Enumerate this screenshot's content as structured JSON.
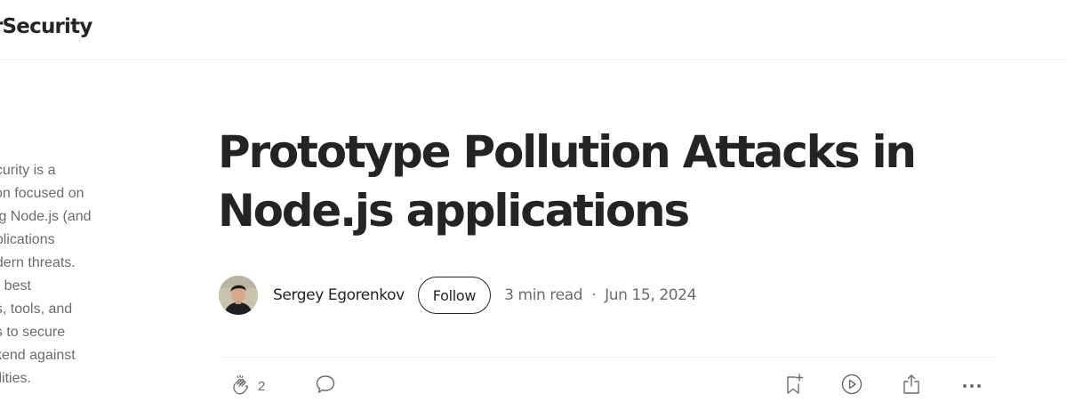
{
  "header": {
    "publication": "rSecurity"
  },
  "sidebar": {
    "description_lines": [
      "ecurity is a",
      "tion focused on",
      "ing Node.js (and",
      "pplications",
      "odern threats.",
      "er best",
      "es, tools, and",
      "es to secure",
      "ckend against",
      "bilities."
    ]
  },
  "article": {
    "title_lines": [
      "Prototype Pollution Attacks in",
      "Node.js applications"
    ],
    "author": "Sergey Egorenkov",
    "follow_label": "Follow",
    "read_time": "3 min read",
    "separator": "·",
    "date": "Jun 15, 2024"
  },
  "actions": {
    "clap_count": "2",
    "icons": [
      "clap-icon",
      "comment-icon",
      "bookmark-add-icon",
      "listen-play-icon",
      "share-icon",
      "more-icon"
    ]
  }
}
